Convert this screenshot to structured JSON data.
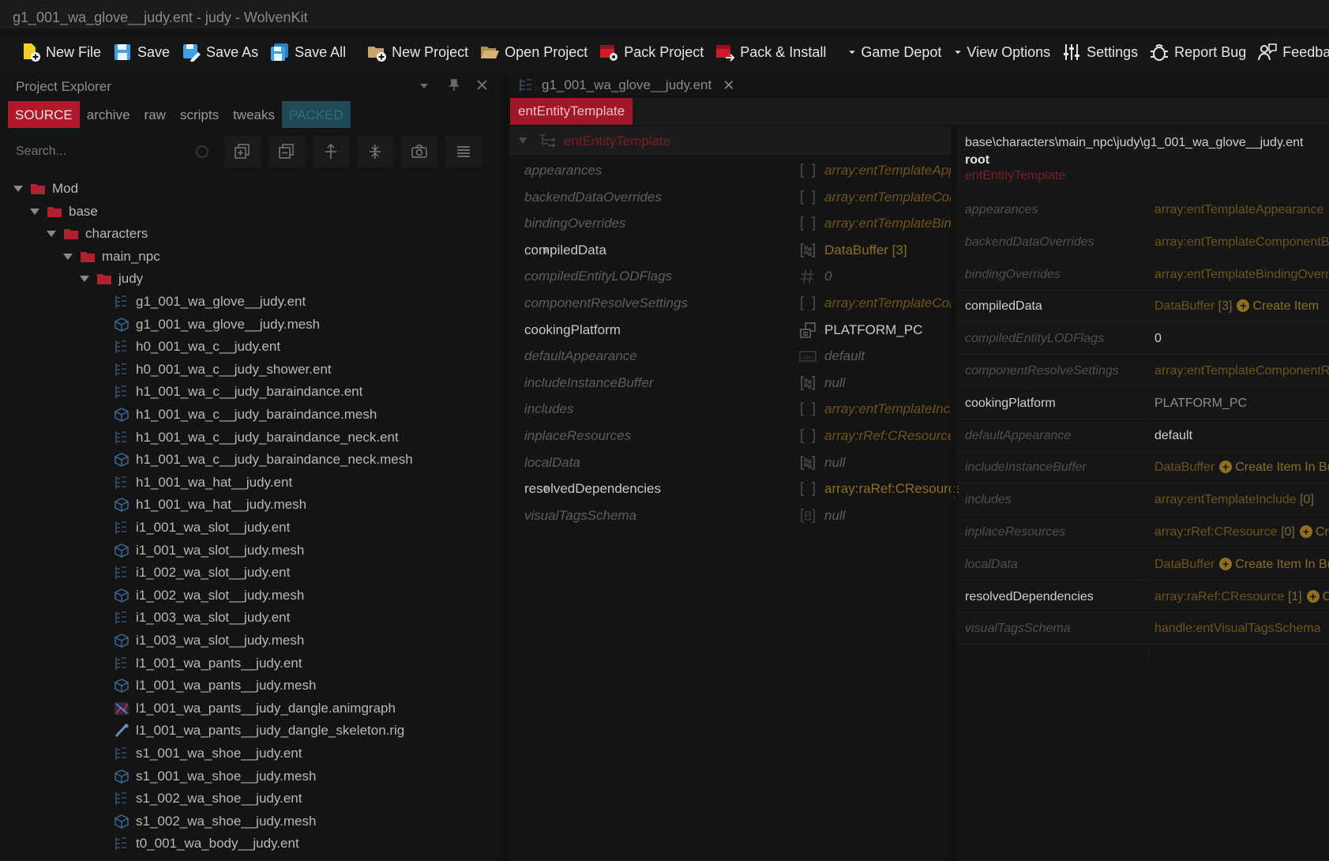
{
  "window": {
    "title": "g1_001_wa_glove__judy.ent - judy - WolvenKit"
  },
  "toolbar": {
    "new_file": "New File",
    "save": "Save",
    "save_as": "Save As",
    "save_all": "Save All",
    "new_project": "New Project",
    "open_project": "Open Project",
    "pack_project": "Pack Project",
    "pack_install": "Pack & Install",
    "game_depot": "Game Depot",
    "view_options": "View Options",
    "settings": "Settings",
    "report_bug": "Report Bug",
    "feedback": "Feedback"
  },
  "project_explorer": {
    "title": "Project Explorer",
    "tabs": [
      "SOURCE",
      "archive",
      "raw",
      "scripts",
      "tweaks",
      "PACKED"
    ],
    "search_placeholder": "Search...",
    "tree": [
      {
        "label": "Mod",
        "depth": 0,
        "kind": "folder"
      },
      {
        "label": "base",
        "depth": 1,
        "kind": "folder"
      },
      {
        "label": "characters",
        "depth": 2,
        "kind": "folder"
      },
      {
        "label": "main_npc",
        "depth": 3,
        "kind": "folder"
      },
      {
        "label": "judy",
        "depth": 4,
        "kind": "folder"
      },
      {
        "label": "g1_001_wa_glove__judy.ent",
        "depth": 5,
        "kind": "ent"
      },
      {
        "label": "g1_001_wa_glove__judy.mesh",
        "depth": 5,
        "kind": "mesh"
      },
      {
        "label": "h0_001_wa_c__judy.ent",
        "depth": 5,
        "kind": "ent"
      },
      {
        "label": "h0_001_wa_c__judy_shower.ent",
        "depth": 5,
        "kind": "ent"
      },
      {
        "label": "h1_001_wa_c__judy_baraindance.ent",
        "depth": 5,
        "kind": "ent"
      },
      {
        "label": "h1_001_wa_c__judy_baraindance.mesh",
        "depth": 5,
        "kind": "mesh"
      },
      {
        "label": "h1_001_wa_c__judy_baraindance_neck.ent",
        "depth": 5,
        "kind": "ent"
      },
      {
        "label": "h1_001_wa_c__judy_baraindance_neck.mesh",
        "depth": 5,
        "kind": "mesh"
      },
      {
        "label": "h1_001_wa_hat__judy.ent",
        "depth": 5,
        "kind": "ent"
      },
      {
        "label": "h1_001_wa_hat__judy.mesh",
        "depth": 5,
        "kind": "mesh"
      },
      {
        "label": "i1_001_wa_slot__judy.ent",
        "depth": 5,
        "kind": "ent"
      },
      {
        "label": "i1_001_wa_slot__judy.mesh",
        "depth": 5,
        "kind": "mesh"
      },
      {
        "label": "i1_002_wa_slot__judy.ent",
        "depth": 5,
        "kind": "ent"
      },
      {
        "label": "i1_002_wa_slot__judy.mesh",
        "depth": 5,
        "kind": "mesh"
      },
      {
        "label": "i1_003_wa_slot__judy.ent",
        "depth": 5,
        "kind": "ent"
      },
      {
        "label": "i1_003_wa_slot__judy.mesh",
        "depth": 5,
        "kind": "mesh"
      },
      {
        "label": "l1_001_wa_pants__judy.ent",
        "depth": 5,
        "kind": "ent"
      },
      {
        "label": "l1_001_wa_pants__judy.mesh",
        "depth": 5,
        "kind": "mesh"
      },
      {
        "label": "l1_001_wa_pants__judy_dangle.animgraph",
        "depth": 5,
        "kind": "animgraph"
      },
      {
        "label": "l1_001_wa_pants__judy_dangle_skeleton.rig",
        "depth": 5,
        "kind": "rig"
      },
      {
        "label": "s1_001_wa_shoe__judy.ent",
        "depth": 5,
        "kind": "ent"
      },
      {
        "label": "s1_001_wa_shoe__judy.mesh",
        "depth": 5,
        "kind": "mesh"
      },
      {
        "label": "s1_002_wa_shoe__judy.ent",
        "depth": 5,
        "kind": "ent"
      },
      {
        "label": "s1_002_wa_shoe__judy.mesh",
        "depth": 5,
        "kind": "mesh"
      },
      {
        "label": "t0_001_wa_body__judy.ent",
        "depth": 5,
        "kind": "ent"
      }
    ]
  },
  "editor": {
    "tab_title": "g1_001_wa_glove__judy.ent",
    "breadcrumb": "entEntityTemplate",
    "root_label": "entEntityTemplate",
    "rows": [
      {
        "name": "appearances",
        "value": "array:entTemplateApp",
        "icon": "bracket",
        "strong": false,
        "expandable": false
      },
      {
        "name": "backendDataOverrides",
        "value": "array:entTemplateCor",
        "icon": "bracket",
        "strong": false,
        "expandable": false
      },
      {
        "name": "bindingOverrides",
        "value": "array:entTemplateBin",
        "icon": "bracket",
        "strong": false,
        "expandable": false
      },
      {
        "name": "compiledData",
        "value": "DataBuffer [3]",
        "icon": "buffer",
        "strong": true,
        "expandable": true
      },
      {
        "name": "compiledEntityLODFlags",
        "value": "0",
        "icon": "hash",
        "strong": false,
        "expandable": false
      },
      {
        "name": "componentResolveSettings",
        "value": "array:entTemplateCor",
        "icon": "bracket",
        "strong": false,
        "expandable": false
      },
      {
        "name": "cookingPlatform",
        "value": "PLATFORM_PC",
        "icon": "enum",
        "strong": true,
        "expandable": false
      },
      {
        "name": "defaultAppearance",
        "value": "default",
        "icon": "abc",
        "strong": false,
        "expandable": false
      },
      {
        "name": "includeInstanceBuffer",
        "value": "null",
        "icon": "buffer",
        "strong": false,
        "expandable": false
      },
      {
        "name": "includes",
        "value": "array:entTemplateIncl",
        "icon": "bracket",
        "strong": false,
        "expandable": false
      },
      {
        "name": "inplaceResources",
        "value": "array:rRef:CResource",
        "icon": "bracket",
        "strong": false,
        "expandable": false
      },
      {
        "name": "localData",
        "value": "null",
        "icon": "buffer",
        "strong": false,
        "expandable": false
      },
      {
        "name": "resolvedDependencies",
        "value": "array:raRef:CResource",
        "icon": "bracket",
        "strong": true,
        "expandable": true
      },
      {
        "name": "visualTagsSchema",
        "value": "null",
        "icon": "handle",
        "strong": false,
        "expandable": false
      }
    ]
  },
  "properties": {
    "path": "base\\characters\\main_npc\\judy\\g1_001_wa_glove__judy.ent",
    "root": "root",
    "type": "entEntityTemplate",
    "rows": [
      {
        "key": "appearances",
        "value": "array:entTemplateAppearance",
        "count": "",
        "action": "",
        "strong": false,
        "tone": "gold"
      },
      {
        "key": "backendDataOverrides",
        "value": "array:entTemplateComponentBackendDataOverrideInfo",
        "count": "",
        "action": "",
        "strong": false,
        "tone": "gold"
      },
      {
        "key": "bindingOverrides",
        "value": "array:entTemplateBindingOverride",
        "count": "",
        "action": "",
        "strong": false,
        "tone": "gold"
      },
      {
        "key": "compiledData",
        "value": "DataBuffer",
        "count": "[3]",
        "action": "Create Item",
        "strong": true,
        "tone": "gold"
      },
      {
        "key": "compiledEntityLODFlags",
        "value": "0",
        "count": "",
        "action": "",
        "strong": false,
        "tone": "white"
      },
      {
        "key": "componentResolveSettings",
        "value": "array:entTemplateComponentResolveSettings",
        "count": "",
        "action": "",
        "strong": false,
        "tone": "gold"
      },
      {
        "key": "cookingPlatform",
        "value": "PLATFORM_PC",
        "count": "",
        "action": "",
        "strong": true,
        "tone": "grey"
      },
      {
        "key": "defaultAppearance",
        "value": "default",
        "count": "",
        "action": "",
        "strong": false,
        "tone": "white"
      },
      {
        "key": "includeInstanceBuffer",
        "value": "DataBuffer",
        "count": "",
        "action": "Create Item In Buffer",
        "strong": false,
        "tone": "gold"
      },
      {
        "key": "includes",
        "value": "array:entTemplateInclude",
        "count": "[0]",
        "action": "",
        "strong": false,
        "tone": "gold"
      },
      {
        "key": "inplaceResources",
        "value": "array:rRef:CResource",
        "count": "[0]",
        "action": "Create",
        "strong": false,
        "tone": "gold"
      },
      {
        "key": "localData",
        "value": "DataBuffer",
        "count": "",
        "action": "Create Item In Buffer",
        "strong": false,
        "tone": "gold"
      },
      {
        "key": "resolvedDependencies",
        "value": "array:raRef:CResource",
        "count": "[1]",
        "action": "Create",
        "strong": true,
        "tone": "gold"
      },
      {
        "key": "visualTagsSchema",
        "value": "handle:entVisualTagsSchema",
        "count": "",
        "action": "",
        "strong": false,
        "tone": "gold"
      }
    ]
  },
  "colors": {
    "accent_red": "#b3182a",
    "gold": "#8d6e22",
    "teal": "#1f4a55"
  }
}
